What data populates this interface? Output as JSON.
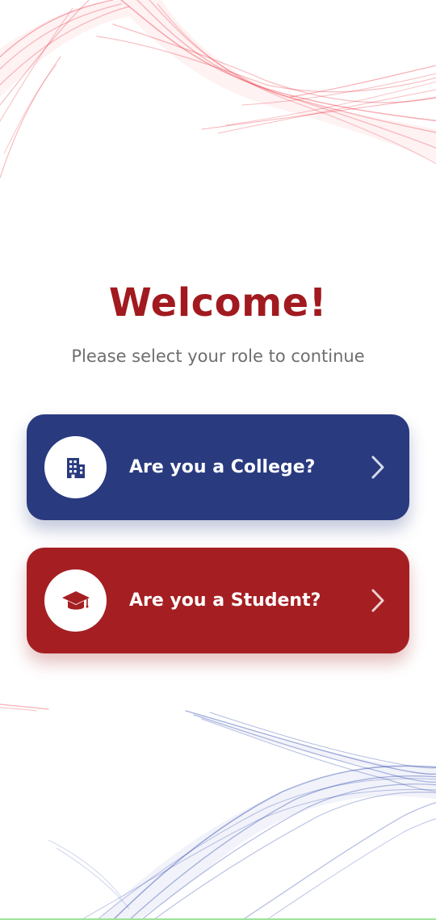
{
  "welcome": {
    "title": "Welcome!",
    "subtitle": "Please select your role to continue"
  },
  "roles": [
    {
      "label": "Are you a College?",
      "icon": "building-icon",
      "color": "#293a7f"
    },
    {
      "label": "Are you a Student?",
      "icon": "graduation-cap-icon",
      "color": "#a51f22"
    }
  ],
  "theme": {
    "accent_red": "#a11a1f",
    "accent_blue": "#293a7f",
    "background": "#ffffff"
  }
}
